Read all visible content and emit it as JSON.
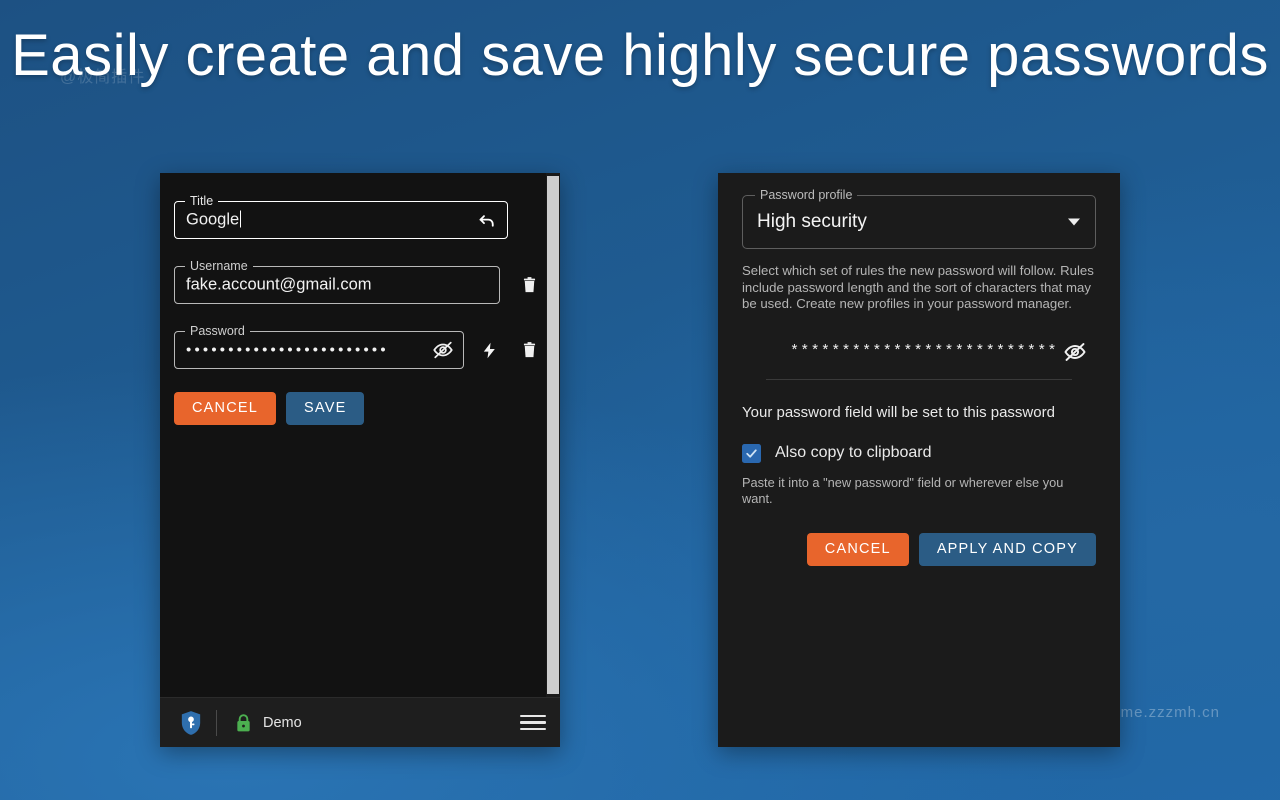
{
  "headline": "Easily create and save highly secure passwords",
  "watermarks": {
    "top_left": "@极简插件",
    "bottom_right": "chrome.zzzmh.cn"
  },
  "colors": {
    "cancel_button": "#e8652c",
    "primary_button": "#2b5c85",
    "checkbox_checked": "#2a68b0",
    "panel_background": "#121212",
    "right_panel_background": "#1b1b1b",
    "vault_lock": "#4caf50",
    "background_blue": "#1f5c92"
  },
  "left_panel": {
    "title_field": {
      "label": "Title",
      "value": "Google",
      "revert_icon": "undo-icon"
    },
    "username_field": {
      "label": "Username",
      "value": "fake.account@gmail.com",
      "delete_icon": "trash-icon"
    },
    "password_field": {
      "label": "Password",
      "value": "••••••••••••••••••••••••",
      "reveal_icon": "eye-off-icon",
      "generate_icon": "lightning-bolt-icon",
      "delete_icon": "trash-icon"
    },
    "buttons": {
      "cancel": "CANCEL",
      "save": "SAVE"
    },
    "status_bar": {
      "app_icon": "key-shield-icon",
      "lock_icon": "padlock-icon",
      "vault_name": "Demo",
      "menu_icon": "hamburger-menu-icon"
    }
  },
  "right_panel": {
    "profile_select": {
      "label": "Password profile",
      "value": "High security",
      "caret_icon": "chevron-down-icon"
    },
    "profile_description": "Select which set of rules the new password will follow. Rules include password length and the sort of characters that may be used. Create new profiles in your password manager.",
    "generated_password": {
      "masked_value": "**************************",
      "reveal_icon": "eye-off-icon"
    },
    "apply_note": "Your password field will be set to this password",
    "clipboard_checkbox": {
      "label": "Also copy to clipboard",
      "checked": true,
      "check_icon": "checkmark-icon"
    },
    "clipboard_note": "Paste it into a \"new password\" field or wherever else you want.",
    "buttons": {
      "cancel": "CANCEL",
      "apply_and_copy": "APPLY AND COPY"
    }
  }
}
